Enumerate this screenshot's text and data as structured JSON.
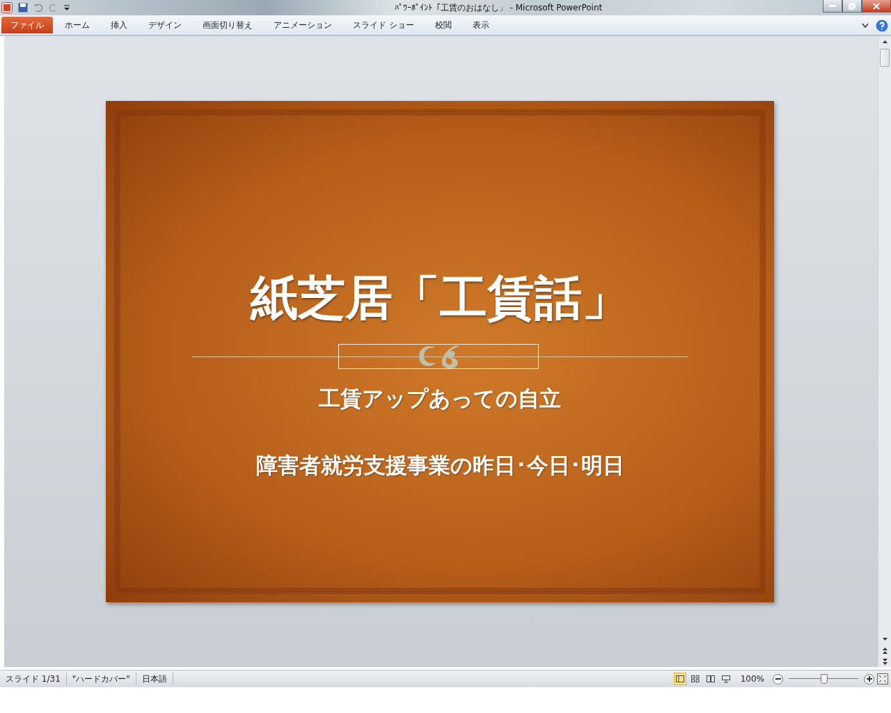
{
  "window": {
    "title": "ﾊﾟﾜｰﾎﾟｲﾝﾄ「工賃のおはなし」 - Microsoft PowerPoint"
  },
  "ribbon_tabs": [
    {
      "label": "ファイル",
      "kind": "file"
    },
    {
      "label": "ホーム",
      "kind": "tab"
    },
    {
      "label": "挿入",
      "kind": "tab"
    },
    {
      "label": "デザイン",
      "kind": "tab"
    },
    {
      "label": "画面切り替え",
      "kind": "tab"
    },
    {
      "label": "アニメーション",
      "kind": "tab"
    },
    {
      "label": "スライド ショー",
      "kind": "tab"
    },
    {
      "label": "校閲",
      "kind": "tab"
    },
    {
      "label": "表示",
      "kind": "tab"
    }
  ],
  "slide": {
    "title": "紙芝居「工賃話」",
    "subtitle_lines": [
      "工賃アップあっての自立",
      "障害者就労支援事業の昨日･今日･明日"
    ]
  },
  "status_bar": {
    "items": [
      "スライド 1/31",
      "\"ハードカバー\"",
      "日本語"
    ],
    "views": [
      {
        "selected": true
      },
      {
        "selected": false
      },
      {
        "selected": false
      },
      {
        "selected": false
      }
    ],
    "zoom": "100%",
    "zoom_slider": {
      "level": 0.5
    }
  }
}
